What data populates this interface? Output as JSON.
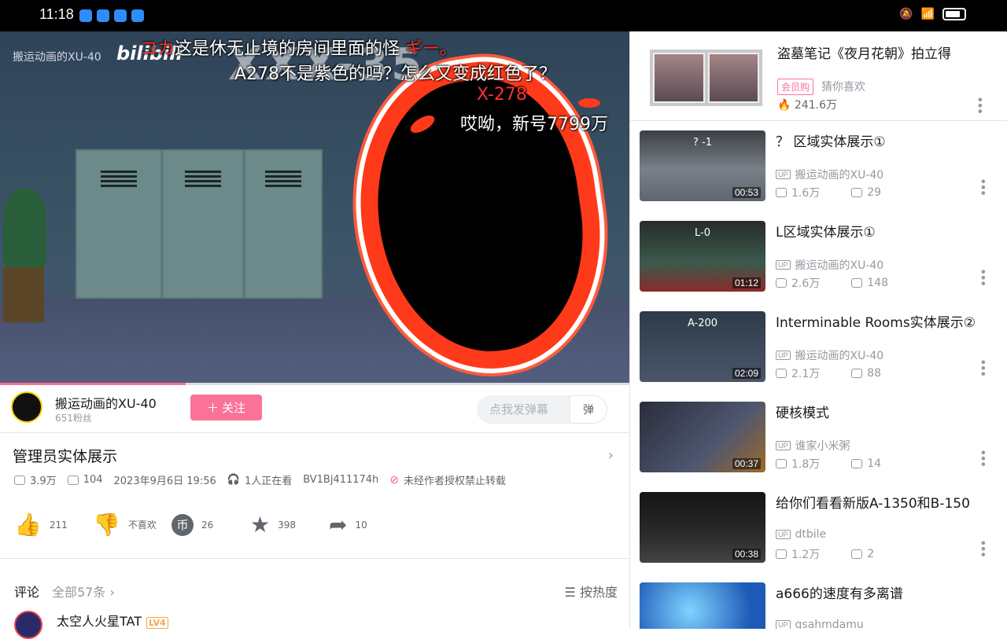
{
  "status": {
    "time": "11:18"
  },
  "player": {
    "watermark": "搬运动画的XU-40",
    "logo": "bilibili",
    "big_title": "XXX-35",
    "danmaku": [
      {
        "pre": "コカ",
        "text": "这是休无止境的房间里面的怪",
        "post": "ギー。"
      },
      {
        "text": "A278不是紫色的吗？怎么又变成红色了？"
      },
      {
        "text": "X-278"
      },
      {
        "text": "哎呦，新号7799万"
      }
    ],
    "progress": 0.295
  },
  "uploader": {
    "name": "搬运动画的XU-40",
    "fans": "651粉丝",
    "follow": "关注",
    "danmaku_placeholder": "点我发弹幕",
    "danmaku_btn": "弹"
  },
  "video": {
    "title": "管理员实体展示",
    "views": "3.9万",
    "danmaku": "104",
    "date": "2023年9月6日 19:56",
    "watching": "1人正在看",
    "bvid": "BV1Bj411174h",
    "copyright": "未经作者授权禁止转载",
    "likes": "211",
    "dislike": "不喜欢",
    "coins": "26",
    "favorites": "398",
    "shares": "10"
  },
  "comments": {
    "label": "评论",
    "count": "全部57条",
    "sort": "按热度",
    "first_user": "太空人火星TAT",
    "first_level": "LV4"
  },
  "ad": {
    "title": "盗墓笔记《夜月花朝》拍立得",
    "badge": "会员购",
    "sub": "猜你喜欢",
    "heat": "241.6万"
  },
  "recommendations": [
    {
      "title": "？ 区域实体展示①",
      "up": "搬运动画的XU-40",
      "views": "1.6万",
      "danmaku": "29",
      "duration": "00:53",
      "overlay": "? -1"
    },
    {
      "title": "L区域实体展示①",
      "up": "搬运动画的XU-40",
      "views": "2.6万",
      "danmaku": "148",
      "duration": "01:12",
      "overlay": "L-0"
    },
    {
      "title": "Interminable  Rooms实体展示②",
      "up": "搬运动画的XU-40",
      "views": "2.1万",
      "danmaku": "88",
      "duration": "02:09",
      "overlay": "A-200"
    },
    {
      "title": "硬核模式",
      "up": "谁家小米粥",
      "views": "1.8万",
      "danmaku": "14",
      "duration": "00:37",
      "overlay": ""
    },
    {
      "title": "给你们看看新版A-1350和B-150",
      "up": "dtbile",
      "views": "1.2万",
      "danmaku": "2",
      "duration": "00:38",
      "overlay": ""
    },
    {
      "title": "a666的速度有多离谱",
      "up": "gsahmdamu",
      "views": "",
      "danmaku": "",
      "duration": "",
      "overlay": ""
    }
  ],
  "colors": {
    "accent": "#fb7299",
    "text": "#18191c",
    "muted": "#9499a0"
  }
}
